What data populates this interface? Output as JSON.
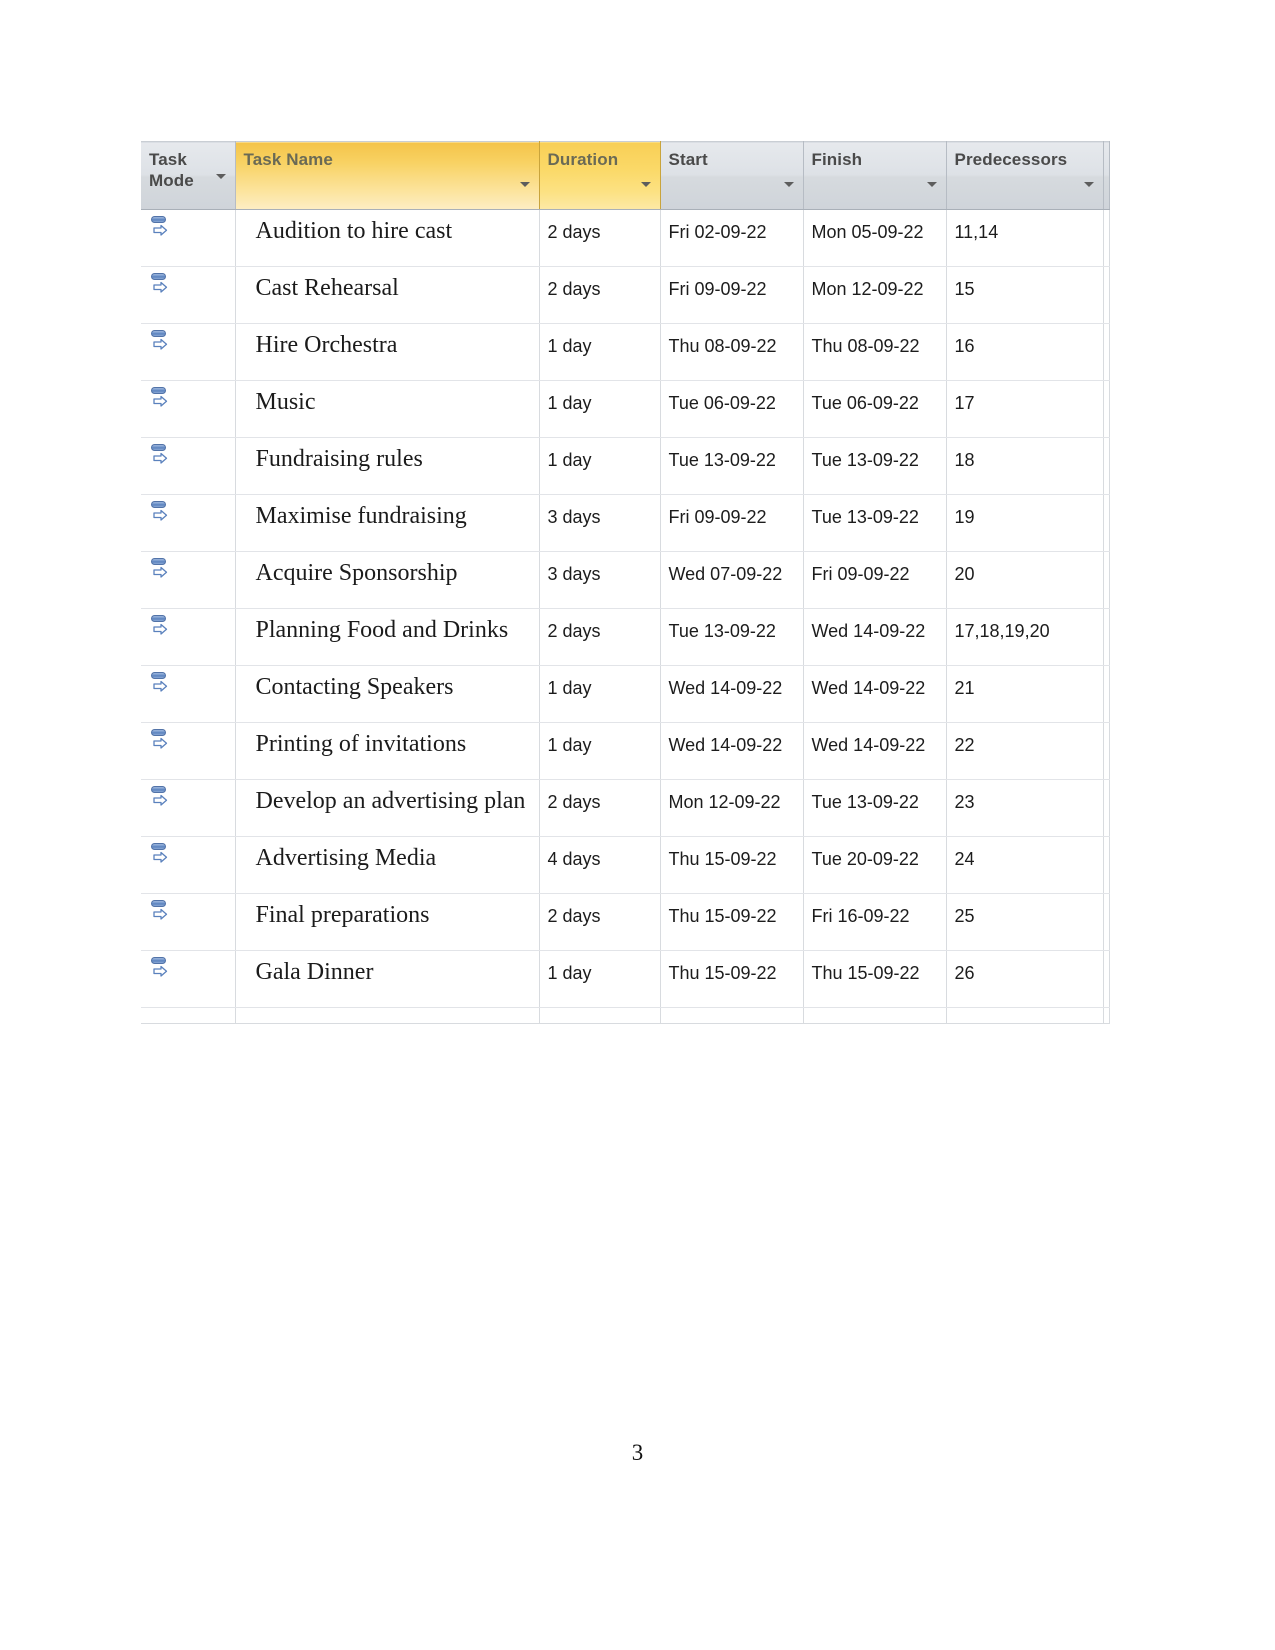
{
  "document": {
    "page_number": "3"
  },
  "grid": {
    "title": "Task Entry Table",
    "columns": [
      {
        "id": "task_mode",
        "label": "Task\nMode",
        "highlight": "none",
        "has_filter_arrow": true
      },
      {
        "id": "task_name",
        "label": "Task Name",
        "highlight": "yellow",
        "has_filter_arrow": true
      },
      {
        "id": "duration",
        "label": "Duration",
        "highlight": "yellow2",
        "has_filter_arrow": true
      },
      {
        "id": "start",
        "label": "Start",
        "highlight": "none",
        "has_filter_arrow": true
      },
      {
        "id": "finish",
        "label": "Finish",
        "highlight": "none",
        "has_filter_arrow": true
      },
      {
        "id": "predecessors",
        "label": "Predecessors",
        "highlight": "none",
        "has_filter_arrow": true
      },
      {
        "id": "clipped",
        "label": "",
        "highlight": "none",
        "has_filter_arrow": false
      }
    ],
    "rows": [
      {
        "mode_icon": "auto-scheduled-icon",
        "task_name": "Audition to hire cast",
        "duration": "2 days",
        "start": "Fri 02-09-22",
        "finish": "Mon 05-09-22",
        "predecessors": "11,14"
      },
      {
        "mode_icon": "auto-scheduled-icon",
        "task_name": "Cast Rehearsal",
        "duration": "2 days",
        "start": "Fri 09-09-22",
        "finish": "Mon 12-09-22",
        "predecessors": "15"
      },
      {
        "mode_icon": "auto-scheduled-icon",
        "task_name": "Hire Orchestra",
        "duration": "1 day",
        "start": "Thu 08-09-22",
        "finish": "Thu 08-09-22",
        "predecessors": "16"
      },
      {
        "mode_icon": "auto-scheduled-icon",
        "task_name": "Music",
        "duration": "1 day",
        "start": "Tue 06-09-22",
        "finish": "Tue 06-09-22",
        "predecessors": "17"
      },
      {
        "mode_icon": "auto-scheduled-icon",
        "task_name": "Fundraising rules",
        "duration": "1 day",
        "start": "Tue 13-09-22",
        "finish": "Tue 13-09-22",
        "predecessors": "18"
      },
      {
        "mode_icon": "auto-scheduled-icon",
        "task_name": "Maximise fundraising",
        "duration": "3 days",
        "start": "Fri 09-09-22",
        "finish": "Tue 13-09-22",
        "predecessors": "19"
      },
      {
        "mode_icon": "auto-scheduled-icon",
        "task_name": "Acquire Sponsorship",
        "duration": "3 days",
        "start": "Wed 07-09-22",
        "finish": "Fri 09-09-22",
        "predecessors": "20"
      },
      {
        "mode_icon": "auto-scheduled-icon",
        "task_name": "Planning Food and Drinks",
        "duration": "2 days",
        "start": "Tue 13-09-22",
        "finish": "Wed 14-09-22",
        "predecessors": "17,18,19,20"
      },
      {
        "mode_icon": "auto-scheduled-icon",
        "task_name": "Contacting Speakers",
        "duration": "1 day",
        "start": "Wed 14-09-22",
        "finish": "Wed 14-09-22",
        "predecessors": "21"
      },
      {
        "mode_icon": "auto-scheduled-icon",
        "task_name": "Printing of invitations",
        "duration": "1 day",
        "start": "Wed 14-09-22",
        "finish": "Wed 14-09-22",
        "predecessors": "22"
      },
      {
        "mode_icon": "auto-scheduled-icon",
        "task_name": "Develop an advertising plan",
        "duration": "2 days",
        "start": "Mon 12-09-22",
        "finish": "Tue 13-09-22",
        "predecessors": "23"
      },
      {
        "mode_icon": "auto-scheduled-icon",
        "task_name": "Advertising Media",
        "duration": "4 days",
        "start": "Thu 15-09-22",
        "finish": "Tue 20-09-22",
        "predecessors": "24"
      },
      {
        "mode_icon": "auto-scheduled-icon",
        "task_name": "Final preparations",
        "duration": "2 days",
        "start": "Thu 15-09-22",
        "finish": "Fri 16-09-22",
        "predecessors": "25"
      },
      {
        "mode_icon": "auto-scheduled-icon",
        "task_name": "Gala Dinner",
        "duration": "1 day",
        "start": "Thu 15-09-22",
        "finish": "Thu 15-09-22",
        "predecessors": "26"
      },
      {
        "mode_icon": "",
        "task_name": "",
        "duration": "",
        "start": "",
        "finish": "",
        "predecessors": ""
      }
    ]
  },
  "colors": {
    "header_gray": "#dde1e6",
    "header_yellow": "#f8d263",
    "header_text": "#4a4a4a",
    "grid_line": "#d8dbdf",
    "icon_blue": "#6f93c9"
  }
}
